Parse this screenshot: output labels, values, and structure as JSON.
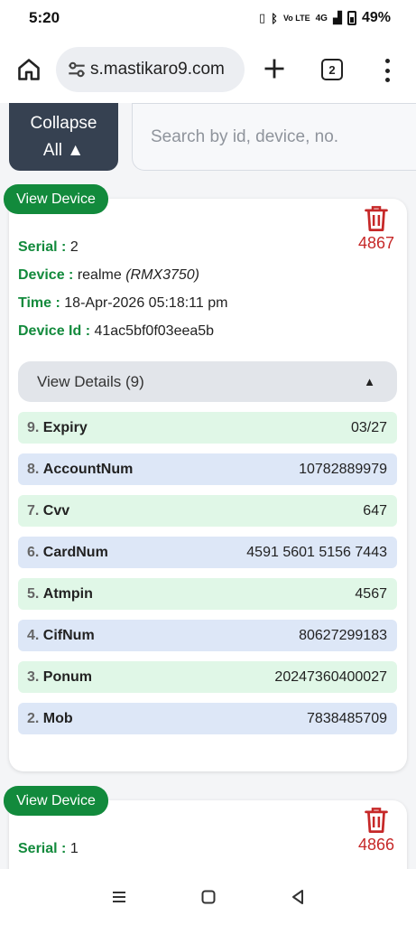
{
  "status_bar": {
    "time": "5:20",
    "network": "4G",
    "volte": "Vo LTE",
    "battery": "49%"
  },
  "browser": {
    "url": "s.mastikaro9.com",
    "tab_count": "2"
  },
  "controls": {
    "collapse_line1": "Collapse",
    "collapse_line2": "All ▲",
    "search_placeholder": "Search by id, device, no."
  },
  "cards": [
    {
      "view_label": "View Device",
      "delete_count": "4867",
      "serial_label": "Serial :",
      "serial": "2",
      "device_label": "Device :",
      "device": "realme",
      "model": "(RMX3750)",
      "time_label": "Time :",
      "time": "18-Apr-2026 05:18:11 pm",
      "device_id_label": "Device Id :",
      "device_id": "41ac5bf0f03eea5b",
      "details_label": "View Details (9)",
      "details_caret": "▲",
      "rows": [
        {
          "num": "9.",
          "key": "Expiry",
          "value": "03/27"
        },
        {
          "num": "8.",
          "key": "AccountNum",
          "value": "10782889979"
        },
        {
          "num": "7.",
          "key": "Cvv",
          "value": "647"
        },
        {
          "num": "6.",
          "key": "CardNum",
          "value": "4591 5601 5156 7443"
        },
        {
          "num": "5.",
          "key": "Atmpin",
          "value": "4567"
        },
        {
          "num": "4.",
          "key": "CifNum",
          "value": "80627299183"
        },
        {
          "num": "3.",
          "key": "Ponum",
          "value": "20247360400027"
        },
        {
          "num": "2.",
          "key": "Mob",
          "value": "7838485709"
        }
      ]
    },
    {
      "view_label": "View Device",
      "delete_count": "4866",
      "serial_label": "Serial :",
      "serial": "1"
    }
  ],
  "colors": {
    "accent_green": "#128a3c",
    "delete_red": "#c62828",
    "collapse_bg": "#364151",
    "row_green": "#e0f7e7",
    "row_blue": "#dde7f7"
  }
}
